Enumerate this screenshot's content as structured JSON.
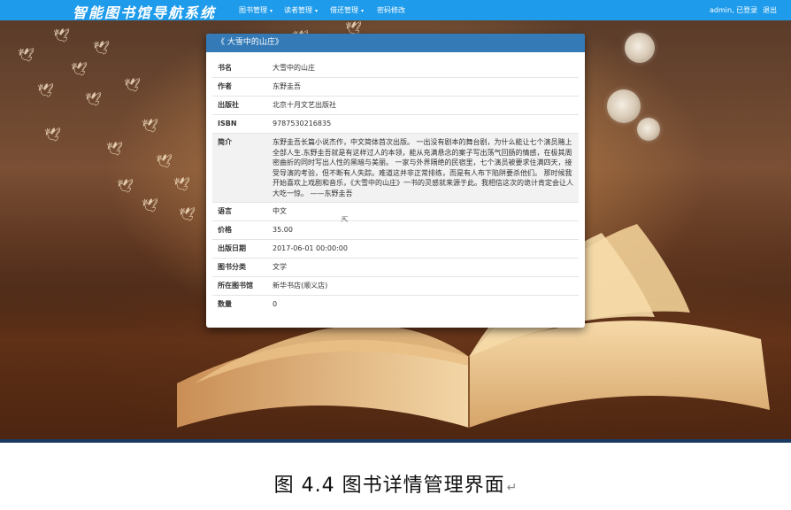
{
  "navbar": {
    "brand": "智能图书馆导航系统",
    "menus": [
      {
        "label": "图书管理",
        "has_dropdown": true
      },
      {
        "label": "读者管理",
        "has_dropdown": true
      },
      {
        "label": "借还管理",
        "has_dropdown": true
      },
      {
        "label": "密码修改",
        "has_dropdown": false
      }
    ],
    "user_status": "admin, 已登录",
    "logout": "退出",
    "bg_color": "#1e9bea"
  },
  "modal": {
    "title": "《 大雪中的山庄》",
    "header_color": "#337ab7",
    "fields": [
      {
        "label": "书名",
        "value": "大雪中的山庄"
      },
      {
        "label": "作者",
        "value": "东野圭吾"
      },
      {
        "label": "出版社",
        "value": "北京十月文艺出版社"
      },
      {
        "label": "ISBN",
        "value": "9787530216835"
      },
      {
        "label": "简介",
        "value": "东野圭吾长篇小说杰作，中文简体首次出版。 一出没有剧本的舞台剧，为什么能让七个演员赌上全部人生.东野圭吾就是有这样过人的本领，能从充满悬念的案子写出荡气回肠的情感，在极其周密曲折的同时写出人性的黑暗与美丽。 一家与外界隔绝的民宿里，七个演员被要求住满四天，接受导演的考验，但不断有人失踪。难道这并非正常排练，而是有人布下陷阱要杀他们。 那时候我开始喜欢上戏剧和音乐，《大雪中的山庄》一书的灵感就来源于此。我相信这次的诡计肯定会让人大吃一惊。 ——东野圭吾"
      },
      {
        "label": "语言",
        "value": "中文"
      },
      {
        "label": "价格",
        "value": "35.00"
      },
      {
        "label": "出版日期",
        "value": "2017-06-01 00:00:00"
      },
      {
        "label": "图书分类",
        "value": "文学"
      },
      {
        "label": "所在图书馆",
        "value": "新华书店(顺义店)"
      },
      {
        "label": "数量",
        "value": "0"
      }
    ]
  },
  "caption": {
    "text": "图 4.4 图书详情管理界面",
    "return_mark": "↵"
  }
}
